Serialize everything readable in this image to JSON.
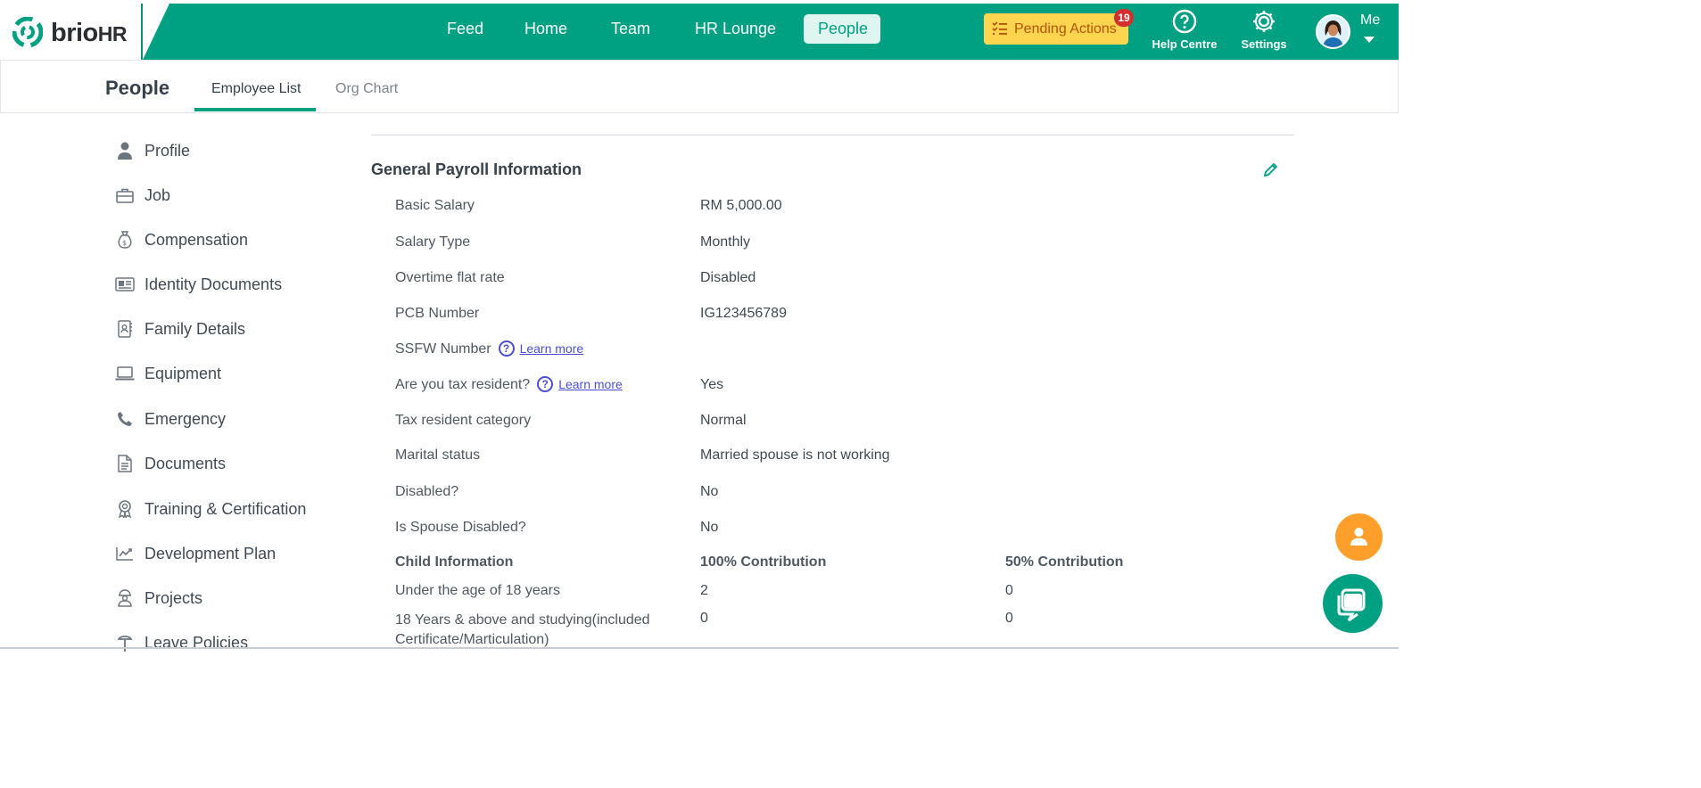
{
  "brand": {
    "name": "brio",
    "suffix": "HR",
    "accent": "#00a082"
  },
  "nav": {
    "items": [
      {
        "label": "Feed"
      },
      {
        "label": "Home"
      },
      {
        "label": "Team"
      },
      {
        "label": "HR Lounge"
      },
      {
        "label": "People",
        "active": true
      }
    ],
    "pending_actions": {
      "label": "Pending Actions",
      "count": "19"
    },
    "help_centre": "Help Centre",
    "settings": "Settings",
    "me": "Me"
  },
  "subheader": {
    "title": "People",
    "tabs": [
      {
        "label": "Employee List",
        "active": true
      },
      {
        "label": "Org Chart"
      }
    ]
  },
  "sidebar": {
    "items": [
      {
        "label": "Profile",
        "icon": "person-icon"
      },
      {
        "label": "Job",
        "icon": "briefcase-icon"
      },
      {
        "label": "Compensation",
        "icon": "money-bag-icon"
      },
      {
        "label": "Identity Documents",
        "icon": "id-card-icon"
      },
      {
        "label": "Family Details",
        "icon": "contacts-icon"
      },
      {
        "label": "Equipment",
        "icon": "laptop-icon"
      },
      {
        "label": "Emergency",
        "icon": "phone-icon"
      },
      {
        "label": "Documents",
        "icon": "document-icon"
      },
      {
        "label": "Training & Certification",
        "icon": "award-icon"
      },
      {
        "label": "Development Plan",
        "icon": "chart-line-icon"
      },
      {
        "label": "Projects",
        "icon": "worker-icon"
      },
      {
        "label": "Leave Policies",
        "icon": "beach-icon"
      }
    ]
  },
  "payroll": {
    "title": "General Payroll Information",
    "rows": [
      {
        "label": "Basic Salary",
        "value": "RM 5,000.00"
      },
      {
        "label": "Salary Type",
        "value": "Monthly"
      },
      {
        "label": "Overtime flat rate",
        "value": "Disabled"
      },
      {
        "label": "PCB Number",
        "value": "IG123456789"
      },
      {
        "label": "SSFW Number",
        "value": "",
        "help": true,
        "learn_more": "Learn more"
      },
      {
        "label": "Are you tax resident?",
        "value": "Yes",
        "help": true,
        "learn_more": "Learn more"
      },
      {
        "label": "Tax resident category",
        "value": "Normal"
      },
      {
        "label": "Marital status",
        "value": "Married spouse is not working"
      },
      {
        "label": "Disabled?",
        "value": "No"
      },
      {
        "label": "Is Spouse Disabled?",
        "value": "No"
      }
    ],
    "child_table": {
      "headers": [
        "Child Information",
        "100% Contribution",
        "50% Contribution"
      ],
      "rows": [
        {
          "label": "Under the age of 18 years",
          "full": "2",
          "half": "0"
        },
        {
          "label_line1": "18 Years & above and studying(included",
          "label_line2": "Certificate/Marticulation)",
          "full": "0",
          "half": "0"
        }
      ]
    }
  }
}
